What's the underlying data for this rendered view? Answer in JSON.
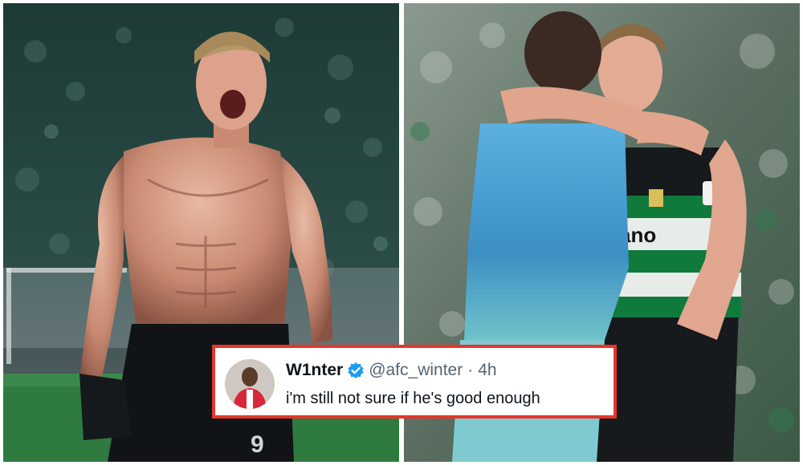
{
  "tweet": {
    "display_name": "W1nter",
    "handle": "@afc_winter",
    "separator": "·",
    "time": "4h",
    "text": "i'm still not sure if he's good enough"
  },
  "colors": {
    "card_border": "#e8352a",
    "verified": "#1d9bf0",
    "sporting_green": "#0f7a3c",
    "keeper_blue": "#4aa3d8"
  },
  "icons": {
    "verified": "verified-badge-icon"
  }
}
